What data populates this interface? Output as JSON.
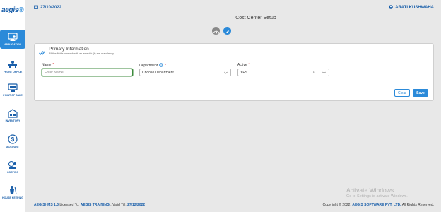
{
  "app": {
    "logo": "aegis"
  },
  "sidebar": {
    "items": [
      {
        "label": "APPLICATION",
        "icon": "monitor-gear-icon",
        "active": true
      },
      {
        "label": "FRONT OFFICE",
        "icon": "reception-desk-icon"
      },
      {
        "label": "POINT OF SALE",
        "icon": "pos-terminal-icon"
      },
      {
        "label": "INVENTORY",
        "icon": "warehouse-icon"
      },
      {
        "label": "ACCOUNT",
        "icon": "dollar-icon"
      },
      {
        "label": "COSTING",
        "icon": "costing-icon"
      },
      {
        "label": "HOUSE KEEPING",
        "icon": "housekeeping-icon"
      }
    ]
  },
  "header": {
    "date": "27/10/2022",
    "user": "ARATI KUSHWAHA"
  },
  "page": {
    "title": "Cost Center Setup"
  },
  "section": {
    "title": "Primary Information",
    "subtitle": "All the fields marked with an asterisk (*) are mandatory."
  },
  "form": {
    "name": {
      "label": "Name",
      "required": "*",
      "placeholder": "Enter Name",
      "value": ""
    },
    "department": {
      "label": "Department",
      "required": "*",
      "placeholder": "Choose Department"
    },
    "active": {
      "label": "Active",
      "required": "*",
      "value": "YES"
    }
  },
  "buttons": {
    "clear": "Clear",
    "save": "Save"
  },
  "footer": {
    "product": "AEGISHMS 1.0",
    "licensed_prefix": "Licensed To:",
    "licensee": "AEGIS TRAINING.",
    "valid_prefix": ", Valid Till:",
    "valid_till": "27/12/2022",
    "copyright_prefix": "Copyright © 2022,",
    "company": "AEGIS SOFTWARE PVT. LTD.",
    "rights": "All Rights Reserved."
  },
  "watermark": {
    "line1": "Activate Windows",
    "line2": "Go to Settings to activate Windows."
  },
  "colors": {
    "brand": "#1a5faa",
    "accent": "#2b8ad9",
    "required": "#d9262b",
    "focus": "#3d8b3d"
  }
}
